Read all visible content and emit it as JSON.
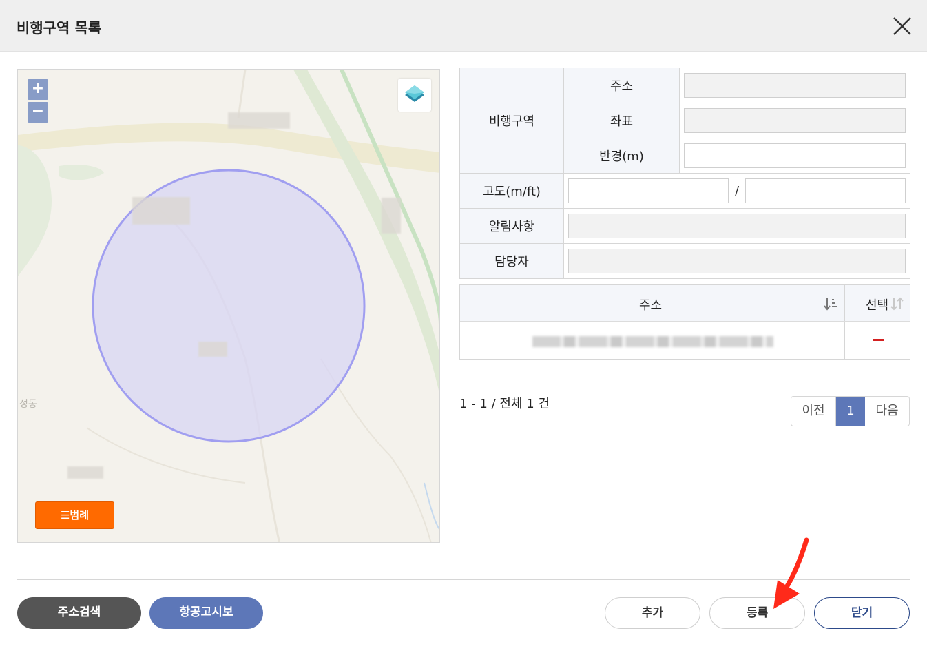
{
  "header": {
    "title": "비행구역 목록",
    "close_icon": "close-icon"
  },
  "map": {
    "zoom_in": "+",
    "zoom_out": "−",
    "legend_label": "☰범례",
    "place_label": "성동",
    "layers_icon": "layers-icon"
  },
  "form": {
    "zone_label": "비행구역",
    "address_label": "주소",
    "address_value": "",
    "coord_label": "좌표",
    "coord_value": "",
    "radius_label": "반경(m)",
    "radius_value": "",
    "altitude_label": "고도(m/ft)",
    "altitude_m": "",
    "altitude_sep": "/",
    "altitude_ft": "",
    "notice_label": "알림사항",
    "notice_value": "",
    "manager_label": "담당자",
    "manager_value": ""
  },
  "list": {
    "col_address": "주소",
    "col_select": "선택",
    "rows": [
      {
        "address": ""
      }
    ]
  },
  "summary": "1 - 1 / 전체 1 건",
  "pager": {
    "prev": "이전",
    "current": "1",
    "next": "다음"
  },
  "buttons": {
    "search": "주소검색",
    "notam": "항공고시보",
    "add": "추가",
    "register": "등록",
    "close": "닫기"
  },
  "colors": {
    "accent": "#5d77b8",
    "legend": "#ff6a00",
    "zone_fill": "#d8d6f4",
    "zone_stroke": "#a09ef0",
    "remove": "#d32020"
  }
}
